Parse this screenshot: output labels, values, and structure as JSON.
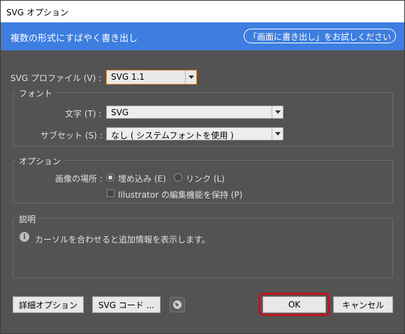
{
  "window": {
    "title": "SVG オプション"
  },
  "banner": {
    "text": "複数の形式にすばやく書き出し",
    "button_label": "「画面に書き出し」をお試しください"
  },
  "profile": {
    "label": "SVG プロファイル (V) :",
    "value": "SVG 1.1"
  },
  "font_group": {
    "title": "フォント",
    "type_label": "文字 (T) :",
    "type_value": "SVG",
    "subset_label": "サブセット (S) :",
    "subset_value": "なし ( システムフォントを使用 )"
  },
  "options_group": {
    "title": "オプション",
    "image_location_label": "画像の場所 :",
    "embed_label": "埋め込み (E)",
    "link_label": "リンク (L)",
    "selected": "embed",
    "preserve_label": "Illustrator の編集機能を保持 (P)",
    "preserve_checked": false
  },
  "description_group": {
    "title": "説明",
    "text": "カーソルを合わせると追加情報を表示します。"
  },
  "buttons": {
    "advanced": "詳細オプション",
    "svg_code": "SVG コード ...",
    "ok": "OK",
    "cancel": "キャンセル"
  },
  "icons": {
    "info": "info-icon",
    "globe": "globe-icon",
    "dropdown": "chevron-down-icon"
  },
  "colors": {
    "banner": "#3d7ee0",
    "ok_highlight": "#c4141c",
    "profile_focus": "#e08a2a"
  }
}
